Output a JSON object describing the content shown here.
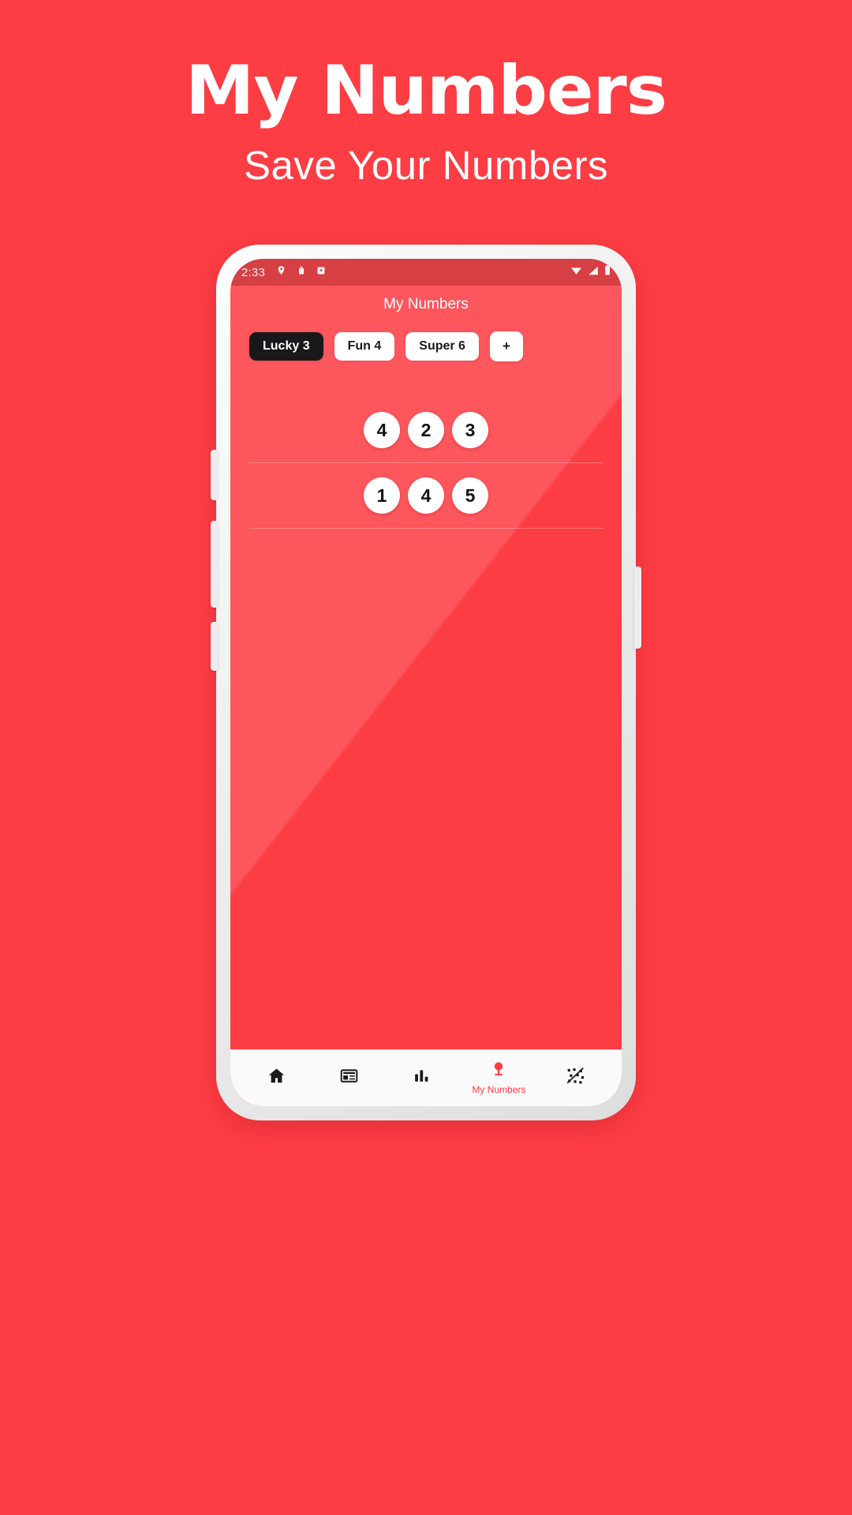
{
  "promo": {
    "title": "My Numbers",
    "subtitle": "Save Your Numbers"
  },
  "colors": {
    "brand_red": "#FD3D44",
    "chip_selected_bg": "#18181A",
    "chip_bg": "#FFFFFF",
    "nav_active": "#FD3D44",
    "nav_inactive": "#1A1A1A",
    "screen_bg": "#FD3D44"
  },
  "phone": {
    "statusbar": {
      "time": "2:33",
      "left_icons": [
        "location-pin-icon",
        "shopping-bag-icon",
        "notification-app-icon"
      ],
      "right_icons": [
        "wifi-icon",
        "cellular-signal-icon",
        "battery-icon"
      ]
    },
    "appbar": {
      "title": "My Numbers"
    },
    "chips": [
      {
        "label": "Lucky 3",
        "selected": true
      },
      {
        "label": "Fun 4",
        "selected": false
      },
      {
        "label": "Super 6",
        "selected": false
      },
      {
        "label": "+",
        "selected": false
      }
    ],
    "number_rows": [
      {
        "numbers": [
          "4",
          "2",
          "3"
        ]
      },
      {
        "numbers": [
          "1",
          "4",
          "5"
        ]
      }
    ],
    "bottom_nav": [
      {
        "icon": "home-icon",
        "label": "",
        "active": false
      },
      {
        "icon": "news-article-icon",
        "label": "",
        "active": false
      },
      {
        "icon": "bar-chart-icon",
        "label": "",
        "active": false
      },
      {
        "icon": "map-pin-icon",
        "label": "My Numbers",
        "active": true
      },
      {
        "icon": "shuffle-scatter-icon",
        "label": "",
        "active": false
      }
    ]
  }
}
